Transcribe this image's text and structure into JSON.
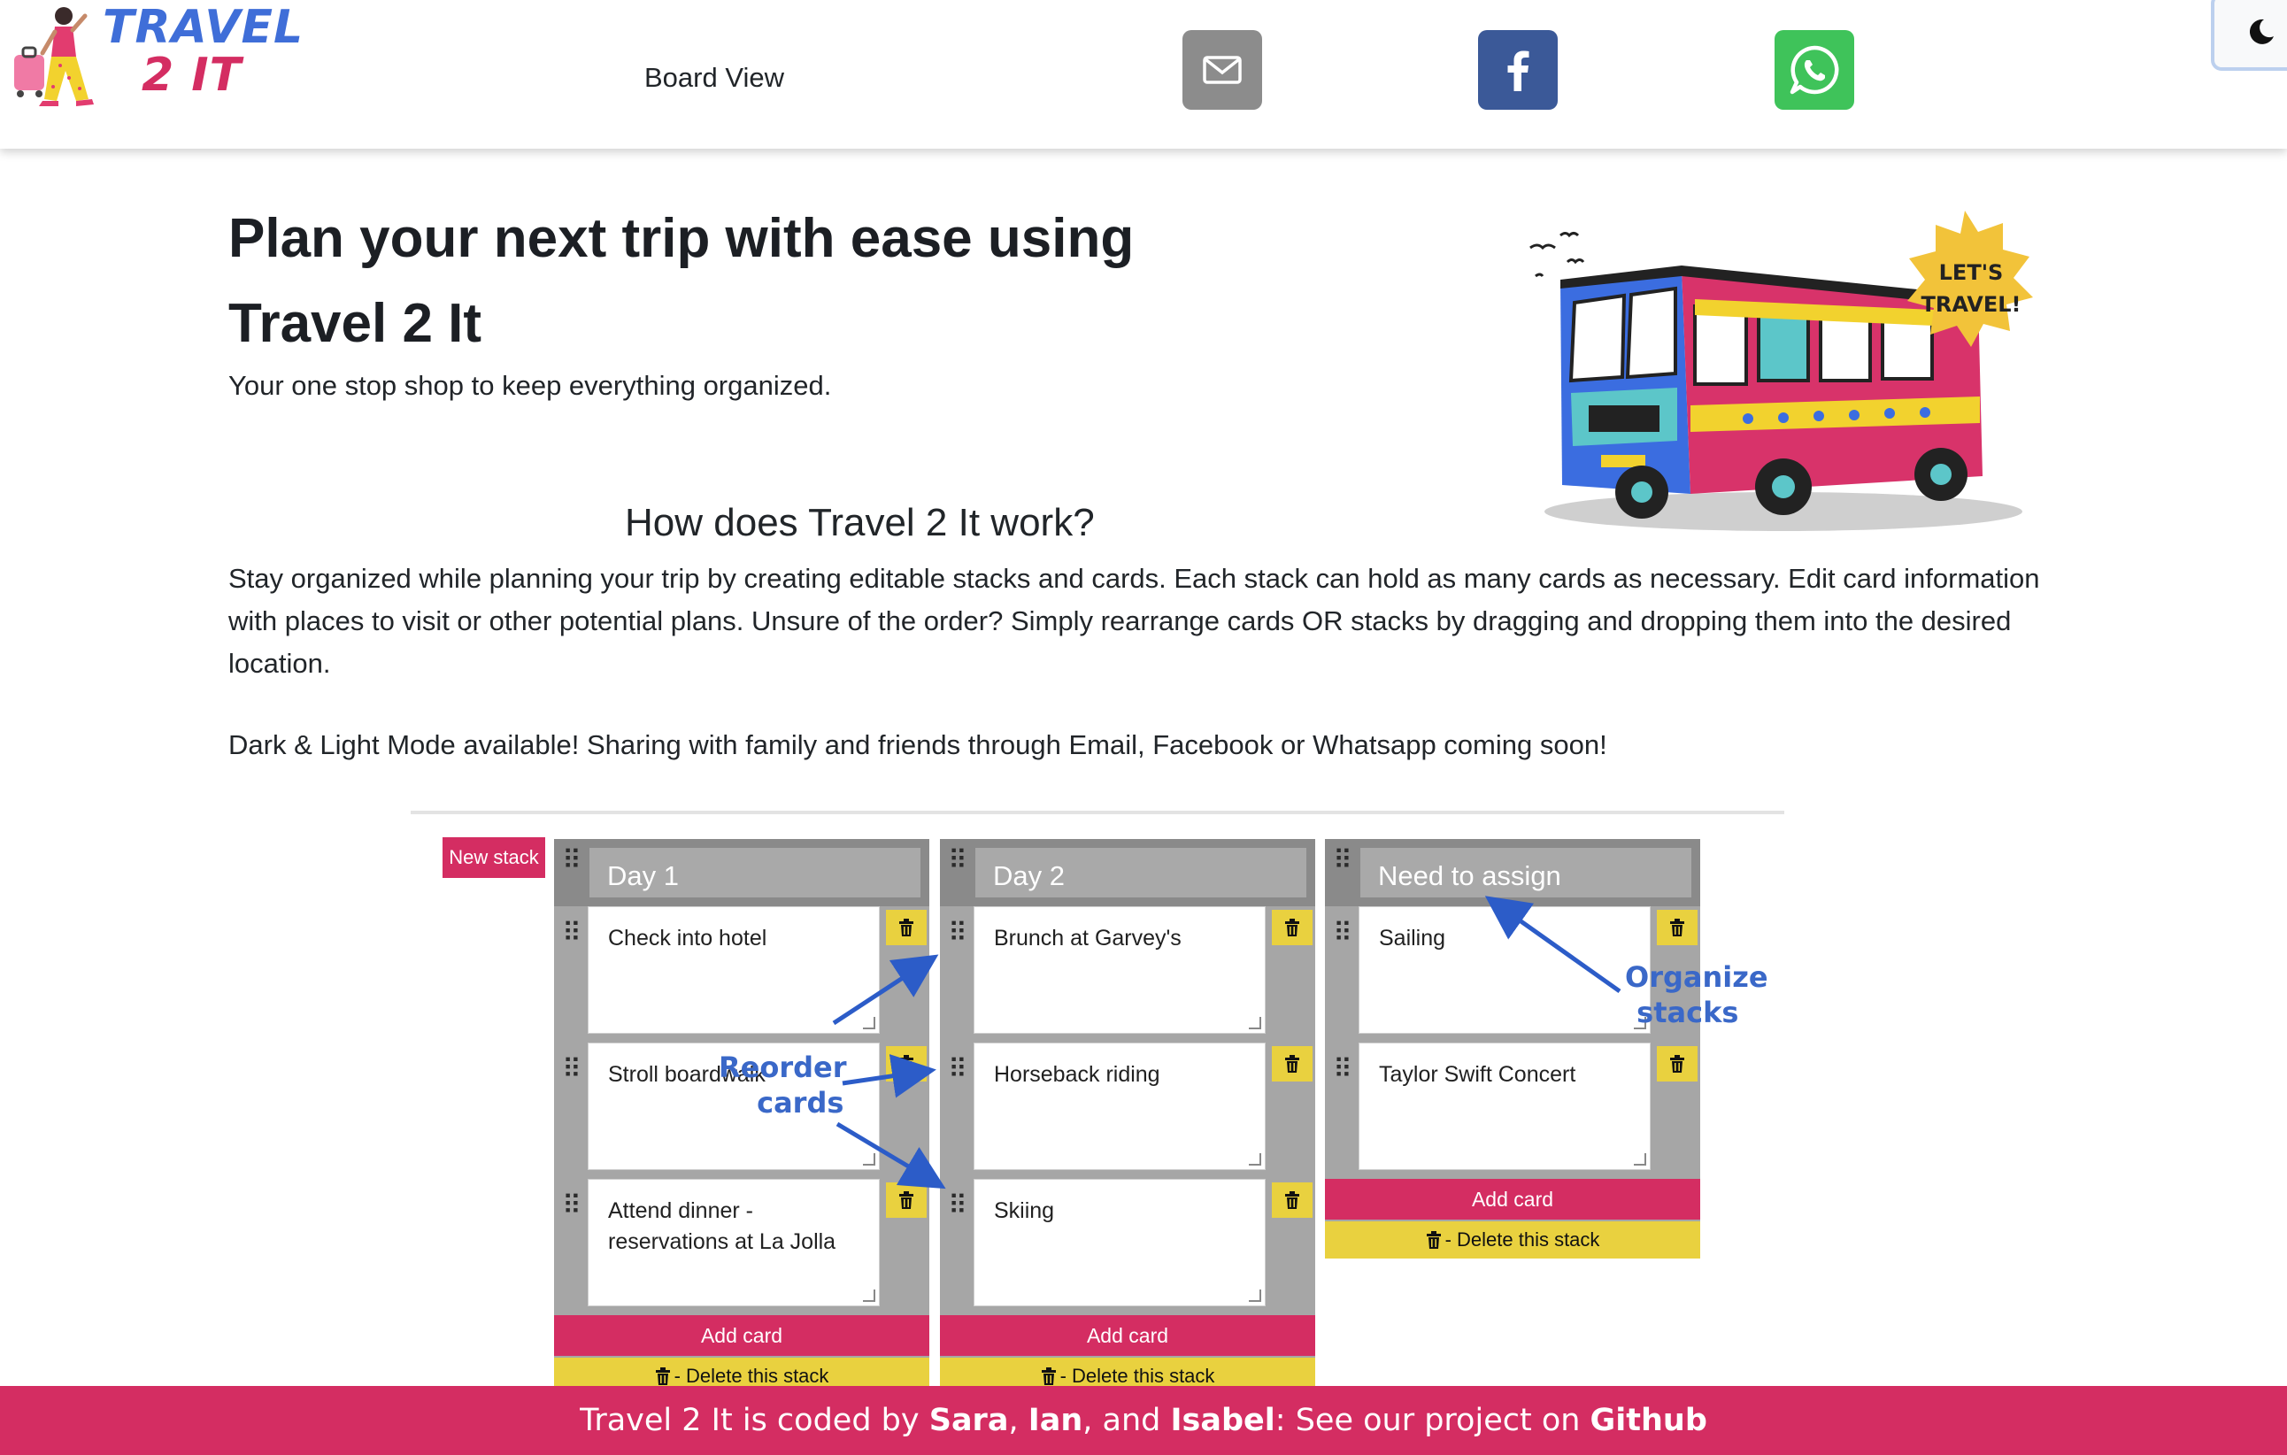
{
  "nav": {
    "logo_line1": "TRAVEL",
    "logo_line2": "2 IT",
    "board_view": "Board View",
    "share": [
      {
        "icon": "mail-icon",
        "color": "#8c8c8c"
      },
      {
        "icon": "facebook-icon",
        "color": "#3b5998"
      },
      {
        "icon": "whatsapp-icon",
        "color": "#3fc35a"
      }
    ],
    "mode_toggle_icon": "moon-icon"
  },
  "hero": {
    "title_line1": "Plan your next trip with ease using",
    "title_line2": "Travel 2 It",
    "subtitle": "Your one stop shop to keep everything organized.",
    "bus_sign_line1": "LET'S",
    "bus_sign_line2": "TRAVEL!"
  },
  "how": {
    "title": "How does Travel 2 It work?",
    "description": "Stay organized while planning your trip by creating editable stacks and cards. Each stack can hold as many cards as necessary. Edit card information with places to visit or other potential plans. Unsure of the order? Simply rearrange cards OR stacks by dragging and dropping them into the desired location.",
    "modes_note": "Dark & Light Mode available! Sharing with family and friends through Email, Facebook or Whatsapp coming soon!"
  },
  "board": {
    "new_stack_label": "New stack",
    "add_card_label": "Add card",
    "delete_stack_label": "- Delete this stack",
    "stacks": [
      {
        "title": "Day 1",
        "cards": [
          "Check into hotel",
          "Stroll boardwalk",
          "Attend dinner - reservations at La Jolla"
        ]
      },
      {
        "title": "Day 2",
        "cards": [
          "Brunch at Garvey's",
          "Horseback riding",
          "Skiing"
        ]
      },
      {
        "title": "Need to assign",
        "cards": [
          "Sailing",
          "Taylor Swift Concert"
        ]
      }
    ],
    "annotation_cards": [
      "Reorder",
      "cards"
    ],
    "annotation_stacks": [
      "Organize",
      "stacks"
    ]
  },
  "footer": {
    "prefix": "Travel 2 It is coded by ",
    "name1": "Sara",
    "sep1": ", ",
    "name2": "Ian",
    "sep2": ", and ",
    "name3": "Isabel",
    "middle": ": See our project on ",
    "link": "Github"
  },
  "colors": {
    "accent_pink": "#d42d62",
    "accent_yellow": "#e9d13f",
    "logo_blue": "#3f6ed8",
    "annotation_blue": "#3a68c8"
  }
}
